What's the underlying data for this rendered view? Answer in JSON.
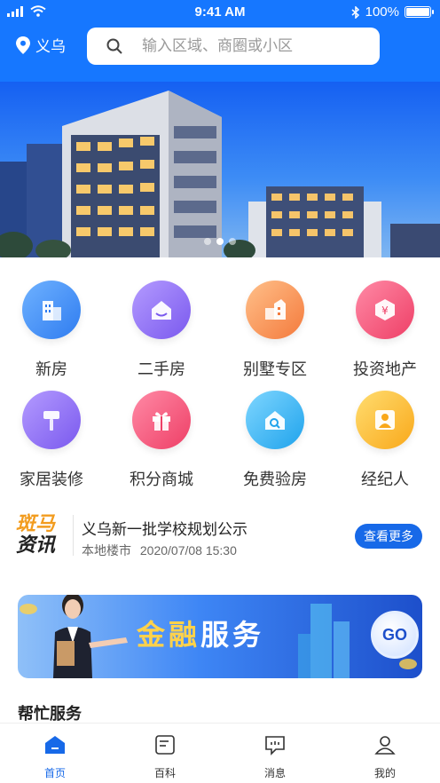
{
  "status_bar": {
    "time": "9:41 AM",
    "battery": "100%"
  },
  "header": {
    "city": "义乌",
    "search_placeholder": "输入区域、商圈或小区"
  },
  "categories": [
    {
      "label": "新房",
      "icon": "new-house-icon",
      "color": "#3a8bf7"
    },
    {
      "label": "二手房",
      "icon": "second-hand-house-icon",
      "color": "#8b6cf2"
    },
    {
      "label": "别墅专区",
      "icon": "villa-icon",
      "color": "#f7894c"
    },
    {
      "label": "投资地产",
      "icon": "investment-icon",
      "color": "#f2476e"
    },
    {
      "label": "家居装修",
      "icon": "decoration-icon",
      "color": "#8b6cf2"
    },
    {
      "label": "积分商城",
      "icon": "gift-icon",
      "color": "#f2476e"
    },
    {
      "label": "免费验房",
      "icon": "inspection-icon",
      "color": "#2fb0f0"
    },
    {
      "label": "经纪人",
      "icon": "agent-icon",
      "color": "#fbb726"
    }
  ],
  "news": {
    "logo_line1": "斑马",
    "logo_line2": "资讯",
    "title": "义乌新一批学校规划公示",
    "source": "本地楼市",
    "datetime": "2020/07/08 15:30",
    "more_label": "查看更多"
  },
  "finance_banner": {
    "title_gold": "金融",
    "title_white": "服务",
    "go_label": "GO"
  },
  "section_title": "帮忙服务",
  "tabs": [
    {
      "label": "首页",
      "icon": "home-icon",
      "active": true
    },
    {
      "label": "百科",
      "icon": "encyclopedia-icon",
      "active": false
    },
    {
      "label": "消息",
      "icon": "message-icon",
      "active": false
    },
    {
      "label": "我的",
      "icon": "profile-icon",
      "active": false
    }
  ],
  "colors": {
    "brand_blue": "#1677ff",
    "accent_orange": "#f29c1f"
  }
}
